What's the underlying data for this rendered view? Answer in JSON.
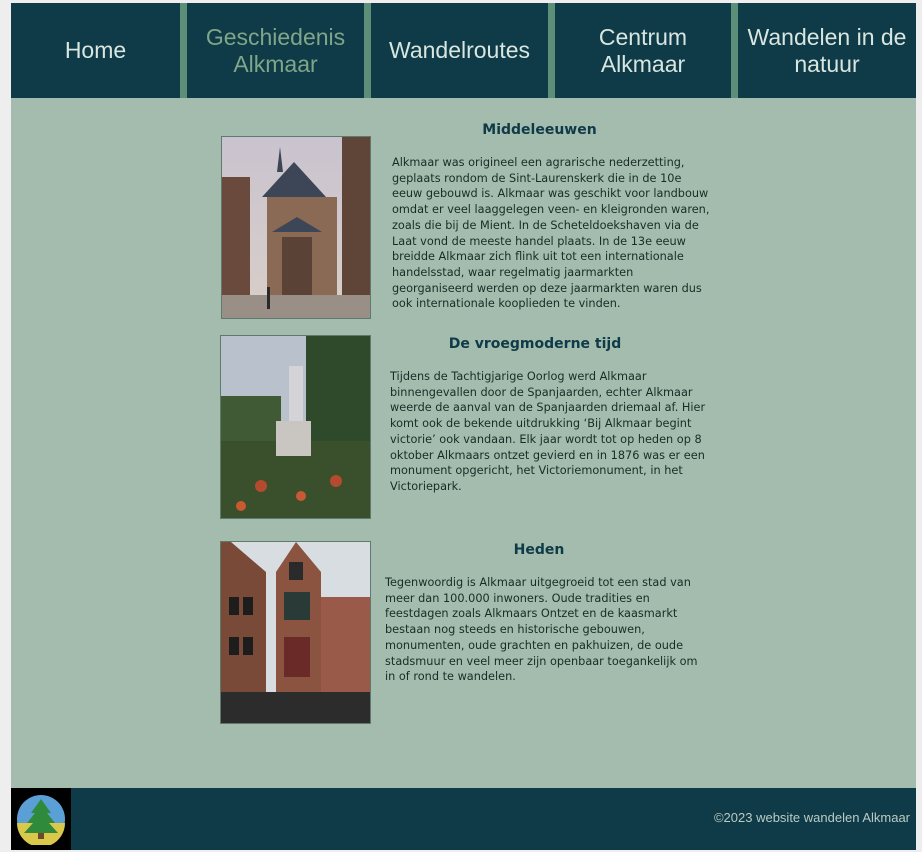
{
  "nav": {
    "items": [
      {
        "label": "Home"
      },
      {
        "label": "Geschiedenis Alkmaar"
      },
      {
        "label": "Wandelroutes"
      },
      {
        "label": "Centrum Alkmaar"
      },
      {
        "label": "Wandelen in de natuur"
      }
    ],
    "active_index": 1,
    "colors": {
      "bar": "#0f3a47",
      "divider": "#5b8f78",
      "text": "#d8e6e0",
      "active_text": "#7fa689"
    }
  },
  "sections": [
    {
      "title": "Middeleeuwen",
      "image": "church-photo",
      "text": "Alkmaar was origineel een agrarische nederzetting, geplaats rondom de Sint-Laurenskerk die in de 10e eeuw gebouwd is. Alkmaar was geschikt voor landbouw omdat er veel laaggelegen veen- en kleigronden waren, zoals die bij de Mient. In de Scheteldoekshaven via de Laat vond de meeste handel plaats. In de 13e eeuw breidde Alkmaar zich flink uit tot een internationale handelsstad, waar regelmatig jaarmarkten georganiseerd werden op deze jaarmarkten waren dus ook internationale kooplieden te vinden."
    },
    {
      "title": "De vroegmoderne tijd",
      "image": "victory-monument-photo",
      "text": "Tijdens de Tachtigjarige Oorlog werd Alkmaar binnengevallen door de Spanjaarden, echter Alkmaar weerde de aanval van de Spanjaarden driemaal af. Hier komt ook de bekende uitdrukking ‘Bij Alkmaar begint victorie’ ook vandaan. Elk jaar wordt tot op heden op 8 oktober Alkmaars ontzet gevierd en in 1876 was er een monument opgericht, het Victoriemonument, in het Victoriepark."
    },
    {
      "title": "Heden",
      "image": "canal-houses-photo",
      "text": "Tegenwoordig is Alkmaar uitgegroeid tot een stad van meer dan 100.000 inwoners. Oude tradities en feestdagen zoals Alkmaars Ontzet en de kaasmarkt bestaan nog steeds en historische gebouwen, monumenten, oude grachten en pakhuizen, de oude stadsmuur en veel meer zijn openbaar toegankelijk om in of rond te wandelen."
    }
  ],
  "footer": {
    "copyright": "©2023 website wandelen Alkmaar",
    "logo": "tree-logo-icon"
  },
  "colors": {
    "page_bg": "#a3bcad",
    "footer_bg": "#0f3a47",
    "heading": "#0f3a47"
  }
}
